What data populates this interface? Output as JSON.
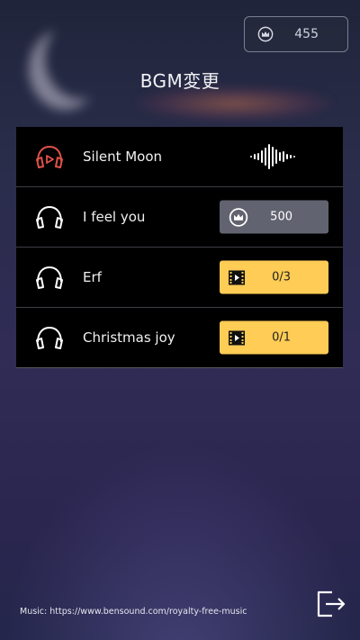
{
  "header": {
    "coins": "455",
    "title": "BGM変更"
  },
  "tracks": [
    {
      "name": "Silent Moon",
      "state": "playing",
      "icon": "headphones-play-icon"
    },
    {
      "name": "I feel you",
      "state": "buy",
      "price": "500",
      "icon": "headphones-icon"
    },
    {
      "name": "Erf",
      "state": "ad",
      "progress": "0/3",
      "icon": "headphones-icon"
    },
    {
      "name": "Christmas joy",
      "state": "ad",
      "progress": "0/1",
      "icon": "headphones-icon"
    }
  ],
  "footer": {
    "credit": "Music: https://www.bensound.com/royalty-free-music",
    "exit_icon": "exit-icon"
  },
  "colors": {
    "active": "#e0524a",
    "ad_button": "#ffcc55",
    "price_button": "#626370"
  }
}
